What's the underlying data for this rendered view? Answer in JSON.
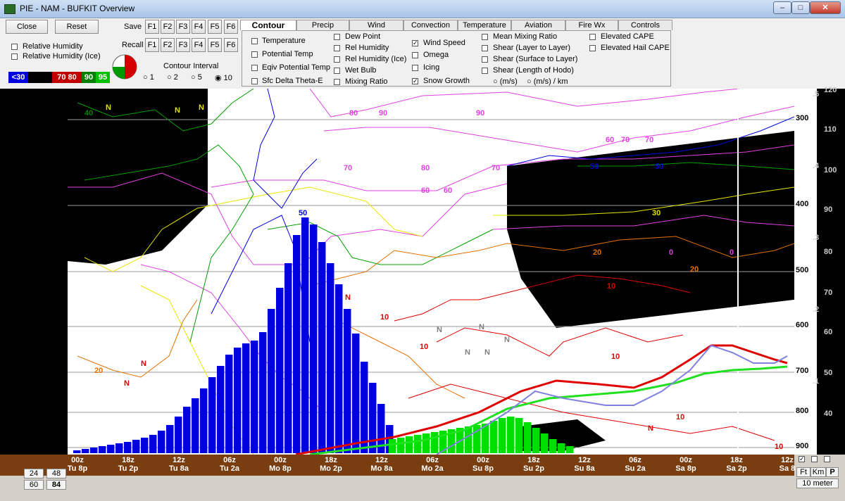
{
  "window": {
    "title": "PIE - NAM - BUFKIT Overview"
  },
  "toolbar": {
    "close_label": "Close",
    "reset_label": "Reset",
    "save_label": "Save",
    "recall_label": "Recall",
    "fkeys": [
      "F1",
      "F2",
      "F3",
      "F4",
      "F5",
      "F6"
    ],
    "rh_label": "Relative Humidity",
    "rh_ice_label": "Relative Humidity (Ice)",
    "contour_interval_label": "Contour Interval",
    "intervals": [
      "1",
      "2",
      "5",
      "10"
    ],
    "selected_interval": "10",
    "rh_legend": [
      "<30",
      "70",
      "80",
      "90",
      "95"
    ]
  },
  "tabs": [
    "Contour",
    "Precip",
    "Wind",
    "Convection",
    "Temperature",
    "Aviation",
    "Fire Wx",
    "Controls"
  ],
  "active_tab": "Contour",
  "contour_options": {
    "col1": [
      "Temperature",
      "Potential Temp",
      "Eqiv Potential Temp",
      "Sfc Delta Theta-E"
    ],
    "col2": [
      "Dew Point",
      "Rel Humidity",
      "Rel Humidity (Ice)",
      "Wet Bulb",
      "Mixing Ratio"
    ],
    "col3": [
      "Wind Speed",
      "Omega",
      "Icing",
      "Snow Growth"
    ],
    "col3_checked": [
      true,
      false,
      false,
      true
    ],
    "col4": [
      "Mean Mixing Ratio",
      "Shear (Layer to Layer)",
      "Shear (Surface to Layer)",
      "Shear (Length of Hodo)"
    ],
    "shear_units": [
      "(m/s)",
      "(m/s) / km"
    ],
    "col5": [
      "Elevated CAPE",
      "Elevated Hail CAPE"
    ]
  },
  "time_axis": [
    {
      "z": "00z",
      "local": "Tu 8p"
    },
    {
      "z": "18z",
      "local": "Tu 2p"
    },
    {
      "z": "12z",
      "local": "Tu 8a"
    },
    {
      "z": "06z",
      "local": "Tu 2a"
    },
    {
      "z": "00z",
      "local": "Mo 8p"
    },
    {
      "z": "18z",
      "local": "Mo 2p"
    },
    {
      "z": "12z",
      "local": "Mo 8a"
    },
    {
      "z": "06z",
      "local": "Mo 2a"
    },
    {
      "z": "00z",
      "local": "Su 8p"
    },
    {
      "z": "18z",
      "local": "Su 2p"
    },
    {
      "z": "12z",
      "local": "Su 8a"
    },
    {
      "z": "06z",
      "local": "Su 2a"
    },
    {
      "z": "00z",
      "local": "Sa 8p"
    },
    {
      "z": "18z",
      "local": "Sa 2p"
    },
    {
      "z": "12z",
      "local": "Sa 8"
    }
  ],
  "right_axis": {
    "pressure": [
      "300",
      "400",
      "500",
      "600",
      "700",
      "800",
      "900"
    ],
    "height": [
      "110",
      "100",
      "90",
      "80",
      "70",
      "60",
      "50",
      "40"
    ],
    "height_top": "120",
    "sigma": [
      ".5",
      ".4",
      ".3",
      ".2",
      ".1"
    ]
  },
  "bottom": {
    "hours": [
      "24",
      "48",
      "60",
      "84"
    ],
    "selected_hours": "84",
    "units": [
      "Ft",
      "Km",
      "P"
    ],
    "surface_label": "10 meter"
  },
  "colors": {
    "precip_blue": "#0000e0",
    "precip_green": "#00e000",
    "axis_brown": "#7a3d10"
  },
  "precip_bars": {
    "blue": [
      4,
      6,
      8,
      10,
      12,
      14,
      16,
      19,
      22,
      26,
      32,
      40,
      52,
      66,
      78,
      92,
      108,
      124,
      140,
      150,
      156,
      160,
      172,
      205,
      235,
      270,
      310,
      335,
      325,
      300,
      270,
      240,
      205,
      170,
      130,
      100,
      70,
      40
    ],
    "green": [
      20,
      22,
      24,
      26,
      28,
      30,
      32,
      34,
      36,
      38,
      40,
      42,
      46,
      50,
      52,
      50,
      44,
      36,
      28,
      20,
      14,
      10
    ]
  }
}
